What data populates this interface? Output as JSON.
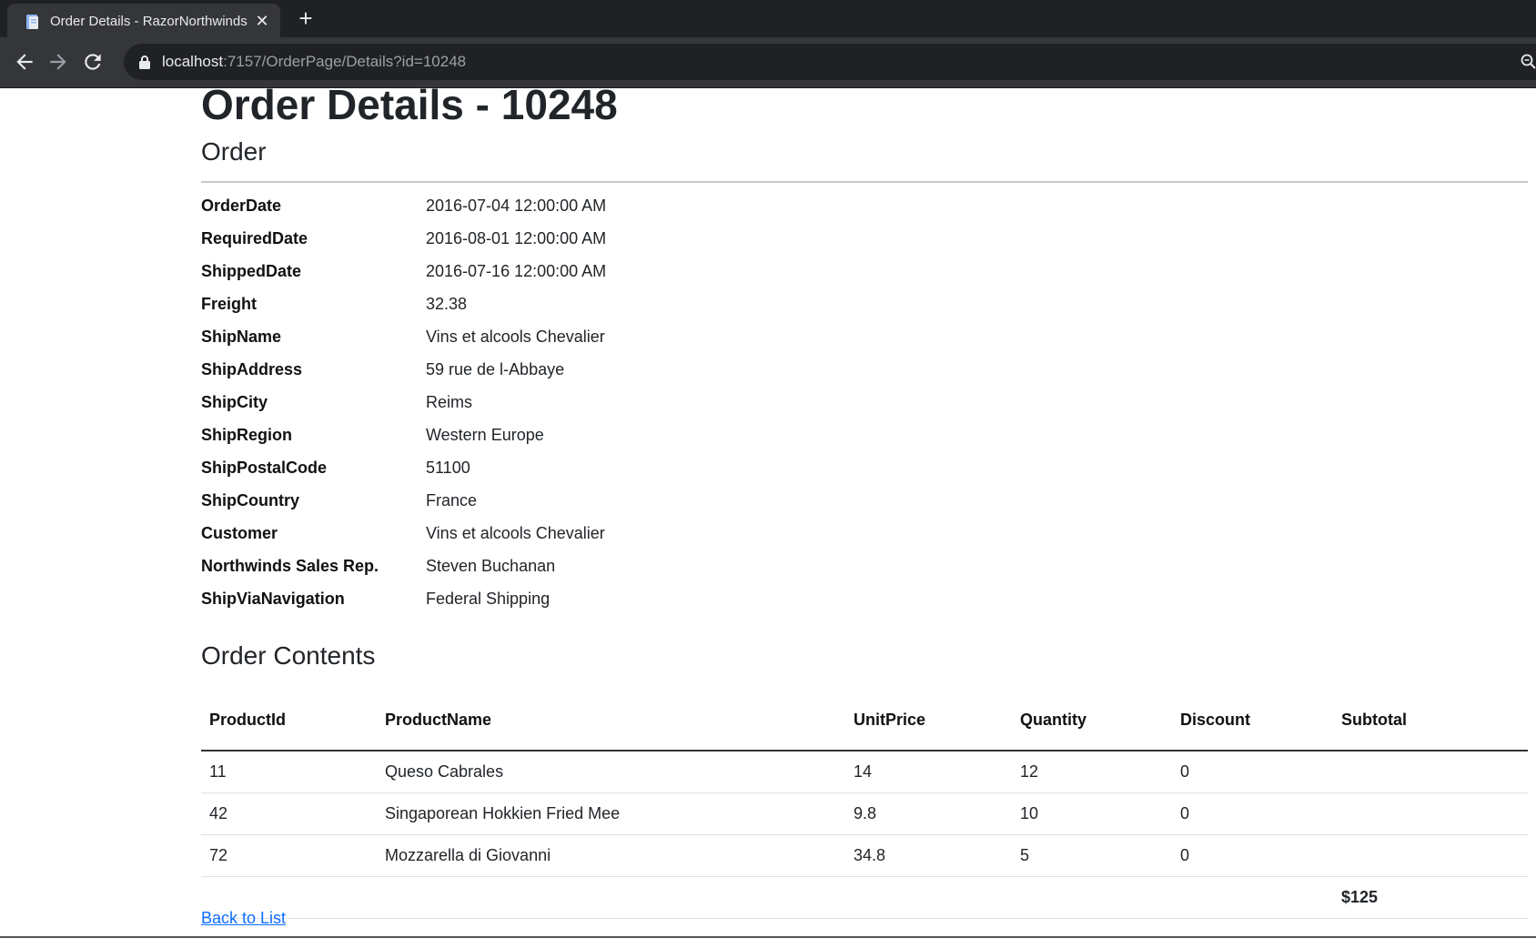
{
  "browser": {
    "tab_title": "Order Details - RazorNorthwinds",
    "url_host": "localhost",
    "url_path": ":7157/OrderPage/Details?id=10248"
  },
  "page": {
    "title": "Order Details - 10248",
    "section_title": "Order",
    "fields": [
      {
        "label": "OrderDate",
        "value": "2016-07-04 12:00:00 AM"
      },
      {
        "label": "RequiredDate",
        "value": "2016-08-01 12:00:00 AM"
      },
      {
        "label": "ShippedDate",
        "value": "2016-07-16 12:00:00 AM"
      },
      {
        "label": "Freight",
        "value": "32.38"
      },
      {
        "label": "ShipName",
        "value": "Vins et alcools Chevalier"
      },
      {
        "label": "ShipAddress",
        "value": "59 rue de l-Abbaye"
      },
      {
        "label": "ShipCity",
        "value": "Reims"
      },
      {
        "label": "ShipRegion",
        "value": "Western Europe"
      },
      {
        "label": "ShipPostalCode",
        "value": "51100"
      },
      {
        "label": "ShipCountry",
        "value": "France"
      },
      {
        "label": "Customer",
        "value": "Vins et alcools Chevalier"
      },
      {
        "label": "Northwinds Sales Rep.",
        "value": "Steven Buchanan"
      },
      {
        "label": "ShipViaNavigation",
        "value": "Federal Shipping"
      }
    ],
    "contents_title": "Order Contents",
    "table": {
      "headers": [
        "ProductId",
        "ProductName",
        "UnitPrice",
        "Quantity",
        "Discount",
        "Subtotal"
      ],
      "rows": [
        [
          "11",
          "Queso Cabrales",
          "14",
          "12",
          "0",
          ""
        ],
        [
          "42",
          "Singaporean Hokkien Fried Mee",
          "9.8",
          "10",
          "0",
          ""
        ],
        [
          "72",
          "Mozzarella di Giovanni",
          "34.8",
          "5",
          "0",
          ""
        ]
      ],
      "total": "$125"
    },
    "back_link": "Back to List"
  }
}
